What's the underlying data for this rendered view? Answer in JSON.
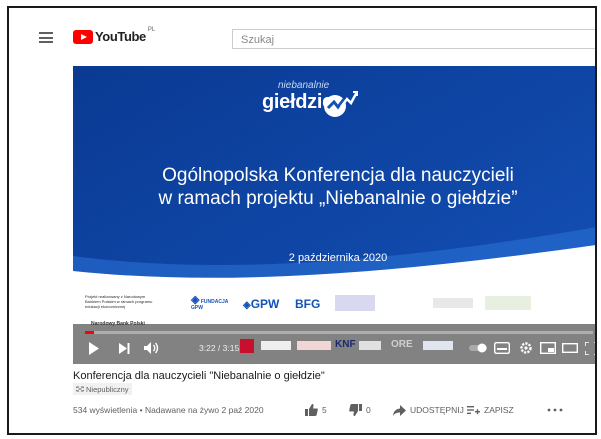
{
  "header": {
    "logo_text": "YouTube",
    "region": "PL",
    "search_placeholder": "Szukaj"
  },
  "slide": {
    "brand_top": "niebanalnie",
    "brand_main": "giełdzie",
    "headline_line1": "Ogólnopolska Konferencja dla nauczycieli",
    "headline_line2": "w ramach projektu „Niebanalnie o giełdzie”",
    "date": "2 października 2020",
    "sponsors": {
      "small_note": "Projekt realizowany z Narodowym Bankiem Polskim w ramach programu edukacji ekonomicznej",
      "fundacja": "FUNDACJA GPW",
      "gpw": "GPW",
      "bfg": "BFG",
      "nbp": "Narodowy Bank Polski",
      "knf": "KNF",
      "ore": "ORE"
    }
  },
  "player": {
    "time": "3:22 / 3:15:24",
    "progress_fraction": 0.017
  },
  "video": {
    "title": "Konferencja dla nauczycieli \"Niebanalnie o giełdzie\"",
    "visibility": "Niepubliczny",
    "meta": "534 wyświetlenia • Nadawane na żywo 2 paź 2020",
    "likes": "5",
    "dislikes": "0",
    "share": "UDOSTĘPNIJ",
    "save": "ZAPISZ"
  },
  "colors": {
    "brand_red": "#ff0000",
    "slide_blue": "#0c3f9a"
  }
}
